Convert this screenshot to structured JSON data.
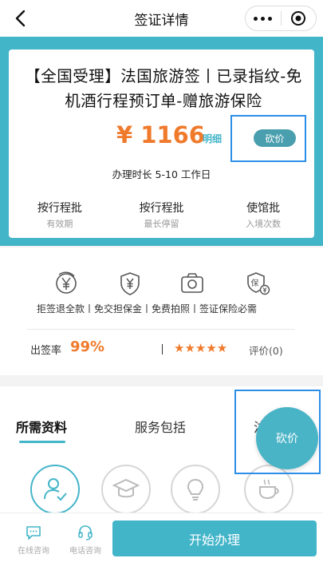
{
  "header": {
    "title": "签证详情"
  },
  "product": {
    "title": "【全国受理】法国旅游签丨已录指纹-免机酒行程预订单-赠旅游保险",
    "price": "¥ 1166",
    "price_detail": "明细",
    "bargain_label": "砍价",
    "duration": "办理时长 5-10 工作日"
  },
  "stats": [
    {
      "label": "按行程批",
      "sub": "有效期"
    },
    {
      "label": "按行程批",
      "sub": "最长停留"
    },
    {
      "label": "使馆批",
      "sub": "入境次数"
    }
  ],
  "guarantees": {
    "labels": "拒签退全款丨免交担保金丨免费拍照丨签证保险必需",
    "icons": [
      "yen-circle-icon",
      "yen-shield-icon",
      "camera-icon",
      "insurance-icon"
    ],
    "insurance_glyph": "保"
  },
  "rating": {
    "rate_label": "出签率",
    "rate_value": "99%",
    "stars": "★★★★★",
    "review_label": "评价(0)"
  },
  "tabs": [
    {
      "label": "所需资料",
      "active": true
    },
    {
      "label": "服务包括",
      "active": false
    },
    {
      "label": "注",
      "active": false
    }
  ],
  "floating": {
    "bargain_label": "砍价"
  },
  "bottom_bar": {
    "online_label": "在线咨询",
    "phone_label": "电话咨询",
    "start_label": "开始办理"
  },
  "colors": {
    "accent": "#43b5c9",
    "price": "#f07a2c",
    "highlight": "#2b8ee8"
  }
}
